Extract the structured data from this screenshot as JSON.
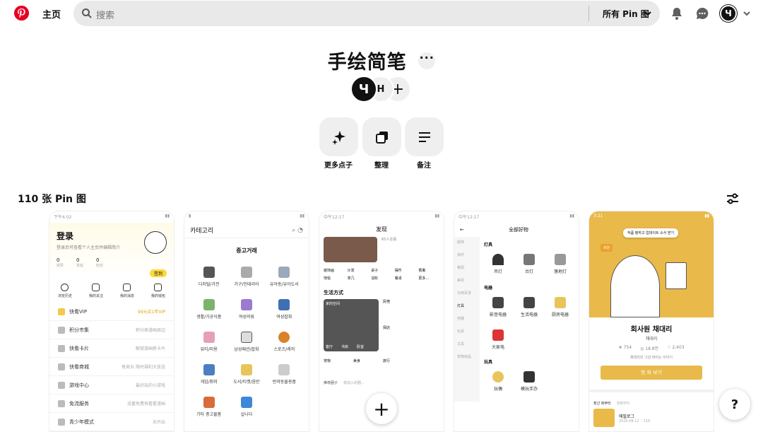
{
  "nav": {
    "home_label": "主页",
    "search_placeholder": "搜索",
    "filter_label": "所有 Pin 图",
    "avatar_letter": "Ч"
  },
  "board": {
    "title": "手绘简笔",
    "more": "···",
    "collaborators": [
      {
        "label": "Ч"
      },
      {
        "label": "H"
      },
      {
        "label": "+"
      }
    ],
    "actions": [
      {
        "label": "更多点子"
      },
      {
        "label": "整理"
      },
      {
        "label": "备注"
      }
    ],
    "pin_count": "110 张 Pin 图"
  },
  "pins": [
    {
      "status": "下午4:02",
      "title": "登录",
      "subtitle": "登录后可查看个人主页并编辑简介",
      "stats": [
        "0",
        "0",
        "0"
      ],
      "stat_labels": [
        "获赞",
        "发帖",
        "粉丝"
      ],
      "badge": "签到",
      "shortcuts": [
        "浏览历史",
        "我的关注",
        "我的消息",
        "我的钱包"
      ],
      "rows": [
        {
          "label": "快看VIP",
          "right": "99元买1年VIP"
        },
        {
          "label": "积分市集",
          "right": "积分换漫画周边"
        },
        {
          "label": "快看卡片",
          "right": "解锁漫画新卡片"
        },
        {
          "label": "快看商城",
          "right": "每周五 限时福利大放送"
        },
        {
          "label": "游戏中心",
          "right": "最好玩的小游戏"
        },
        {
          "label": "免流服务",
          "right": "流量免费快看看漫画"
        },
        {
          "label": "青少年模式",
          "right": "未开启"
        }
      ]
    },
    {
      "header": "카테고리",
      "section": "중고거래",
      "items": [
        "디지털/가전",
        "가구/인테리어",
        "유아동/유아도서",
        "생활/가공식품",
        "여성의류",
        "여성잡화",
        "뷰티/미용",
        "남성패션/잡화",
        "스포츠/레저",
        "게임/취미",
        "도서/티켓/음반",
        "반려동물용품",
        "기타 중고물품",
        "삽니다"
      ]
    },
    {
      "status": "中午12:17",
      "header": "发现",
      "user_label": "65人在看",
      "tags": [
        "装饰画",
        "沙发",
        "桌子",
        "摆件",
        "香薰",
        "地毯",
        "茶几",
        "浴缸",
        "餐桌",
        "更多..."
      ],
      "section": "生活方式",
      "cards": [
        "家的空间",
        "民宿",
        "探店",
        "宠物",
        "美食",
        "旅行"
      ],
      "card_sub": [
        "客厅",
        "书房",
        "卧室"
      ],
      "footer": "推荐圈子",
      "footer_sub": "我加入的圈..."
    },
    {
      "status": "中午12:17",
      "header": "全部好物",
      "side": [
        "服饰",
        "家纺",
        "餐厨",
        "美妆",
        "日用百货",
        "灯具",
        "电器",
        "玩具",
        "文具",
        "宠物用品"
      ],
      "groups": [
        {
          "title": "灯具",
          "items": [
            "吊灯",
            "台灯",
            "落地灯"
          ]
        },
        {
          "title": "电器",
          "items": [
            "影音电器",
            "生活电器",
            "厨房电器",
            "大家电"
          ]
        },
        {
          "title": "玩具",
          "items": [
            "玩偶",
            "模玩手办"
          ]
        }
      ]
    },
    {
      "status": "3:21",
      "tooltip": "작품 평하고 업데이트 소식 받기",
      "badge": "회원",
      "name": "회사원 채대리",
      "author": "채대리",
      "likes": "754",
      "views": "18.8만",
      "comments": "2,403",
      "desc": "채대리의 그냥 버티는 이야기",
      "cta": "첫 화 보기",
      "tabs": [
        "최신 화부터",
        "첫화부터"
      ],
      "episode": "에필로그",
      "ep_date": "2020.08.12",
      "ep_likes": "116"
    }
  ],
  "fab": "+",
  "help": "?"
}
